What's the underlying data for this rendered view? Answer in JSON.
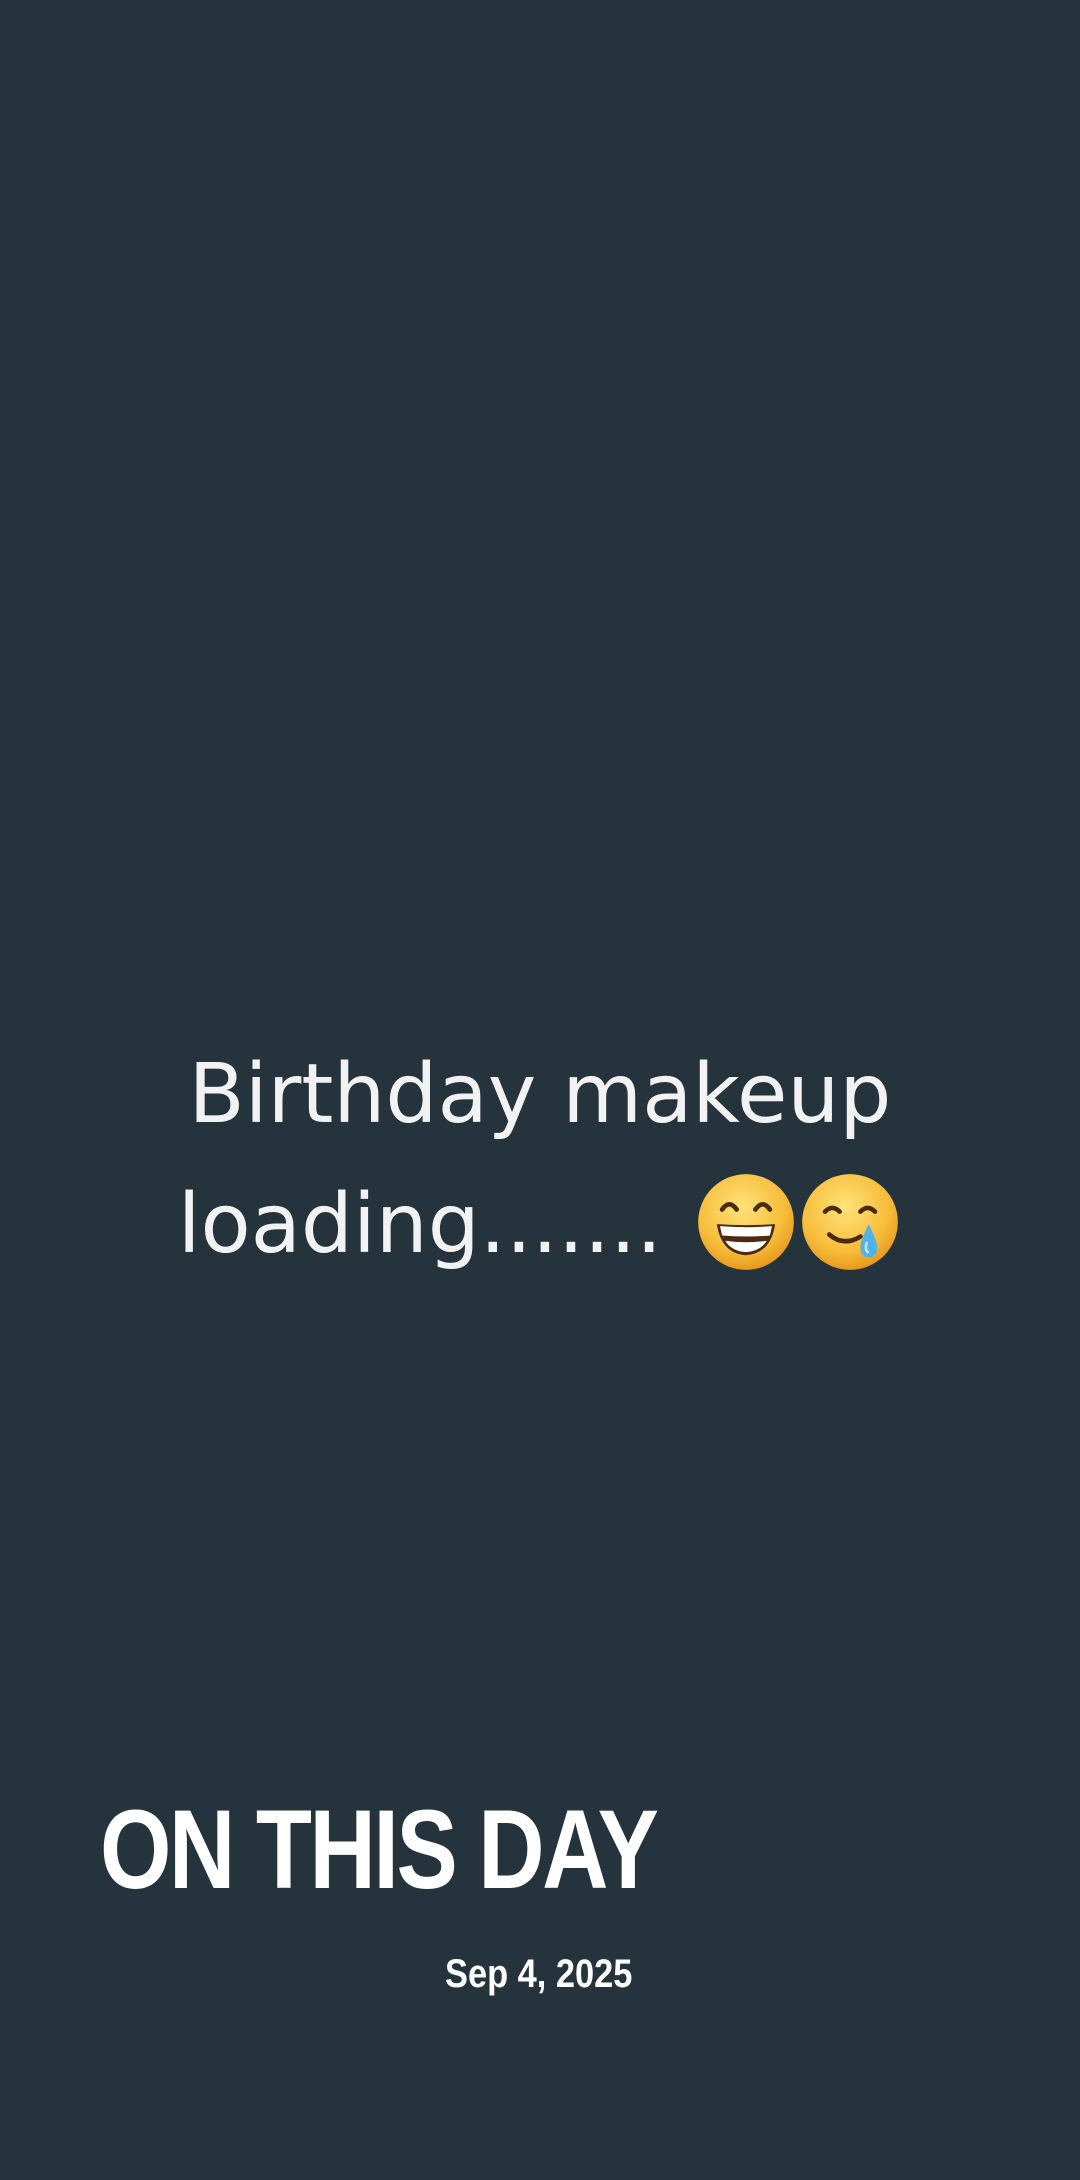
{
  "story": {
    "line1": "Birthday makeup",
    "line2": "loading.......",
    "emojis": [
      "beaming-face-with-smiling-eyes-icon",
      "smiling-face-with-tear-icon"
    ]
  },
  "memory": {
    "heading": "ON THIS DAY",
    "date": "Sep 4, 2025"
  },
  "colors": {
    "background": "#25333d",
    "text": "#f2f2f2",
    "heading": "#ffffff",
    "emoji_face": "#f7bd3a",
    "tear": "#4fb3e8"
  }
}
